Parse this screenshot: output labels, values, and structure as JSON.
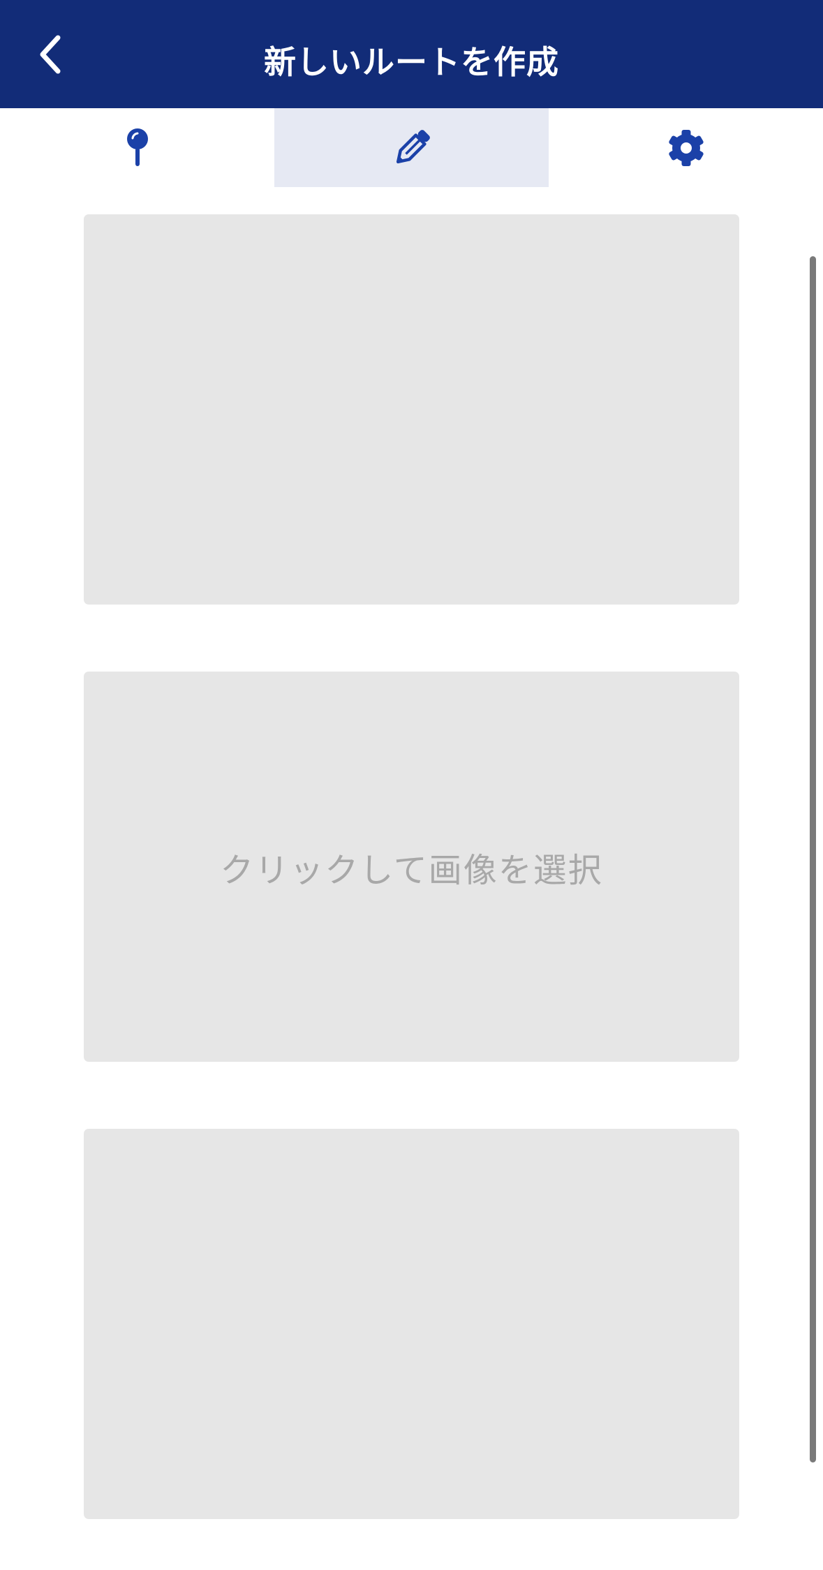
{
  "header": {
    "title": "新しいルートを作成",
    "back_icon": "chevron-left-icon",
    "background_color": "#122c78"
  },
  "tabs": [
    {
      "icon": "map-pin-icon",
      "active": false
    },
    {
      "icon": "pencil-icon",
      "active": true
    },
    {
      "icon": "gear-icon",
      "active": false
    }
  ],
  "accent_color": "#1b41a8",
  "image_slots": [
    {
      "label": ""
    },
    {
      "label": "クリックして画像を選択"
    },
    {
      "label": ""
    }
  ]
}
